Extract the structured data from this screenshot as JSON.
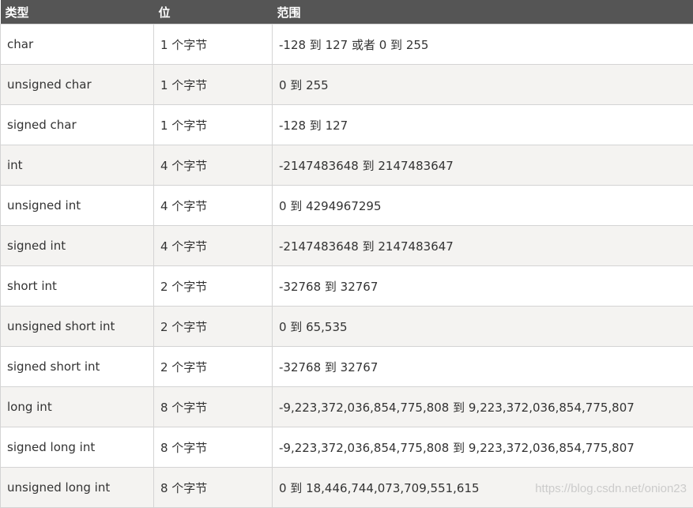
{
  "table": {
    "headers": [
      "类型",
      "位",
      "范围"
    ],
    "rows": [
      {
        "type": "char",
        "size": "1 个字节",
        "range": "-128 到 127 或者 0 到 255"
      },
      {
        "type": "unsigned char",
        "size": "1 个字节",
        "range": "0 到 255"
      },
      {
        "type": "signed char",
        "size": "1 个字节",
        "range": "-128 到 127"
      },
      {
        "type": "int",
        "size": "4 个字节",
        "range": "-2147483648 到 2147483647"
      },
      {
        "type": "unsigned int",
        "size": "4 个字节",
        "range": "0 到 4294967295"
      },
      {
        "type": "signed int",
        "size": "4 个字节",
        "range": "-2147483648 到 2147483647"
      },
      {
        "type": "short int",
        "size": "2 个字节",
        "range": "-32768 到 32767"
      },
      {
        "type": "unsigned short int",
        "size": "2 个字节",
        "range": "0 到 65,535"
      },
      {
        "type": "signed short int",
        "size": "2 个字节",
        "range": "-32768 到 32767"
      },
      {
        "type": "long int",
        "size": "8 个字节",
        "range": "-9,223,372,036,854,775,808 到 9,223,372,036,854,775,807"
      },
      {
        "type": "signed long int",
        "size": "8 个字节",
        "range": "-9,223,372,036,854,775,808 到 9,223,372,036,854,775,807"
      },
      {
        "type": "unsigned long int",
        "size": "8 个字节",
        "range": "0 到 18,446,744,073,709,551,615"
      }
    ]
  },
  "watermark": "https://blog.csdn.net/onion23",
  "colors": {
    "header_bg": "#555555",
    "header_text": "#ffffff",
    "row_alt_bg": "#f4f3f1",
    "text": "#333333",
    "border": "#d4d4d4"
  }
}
